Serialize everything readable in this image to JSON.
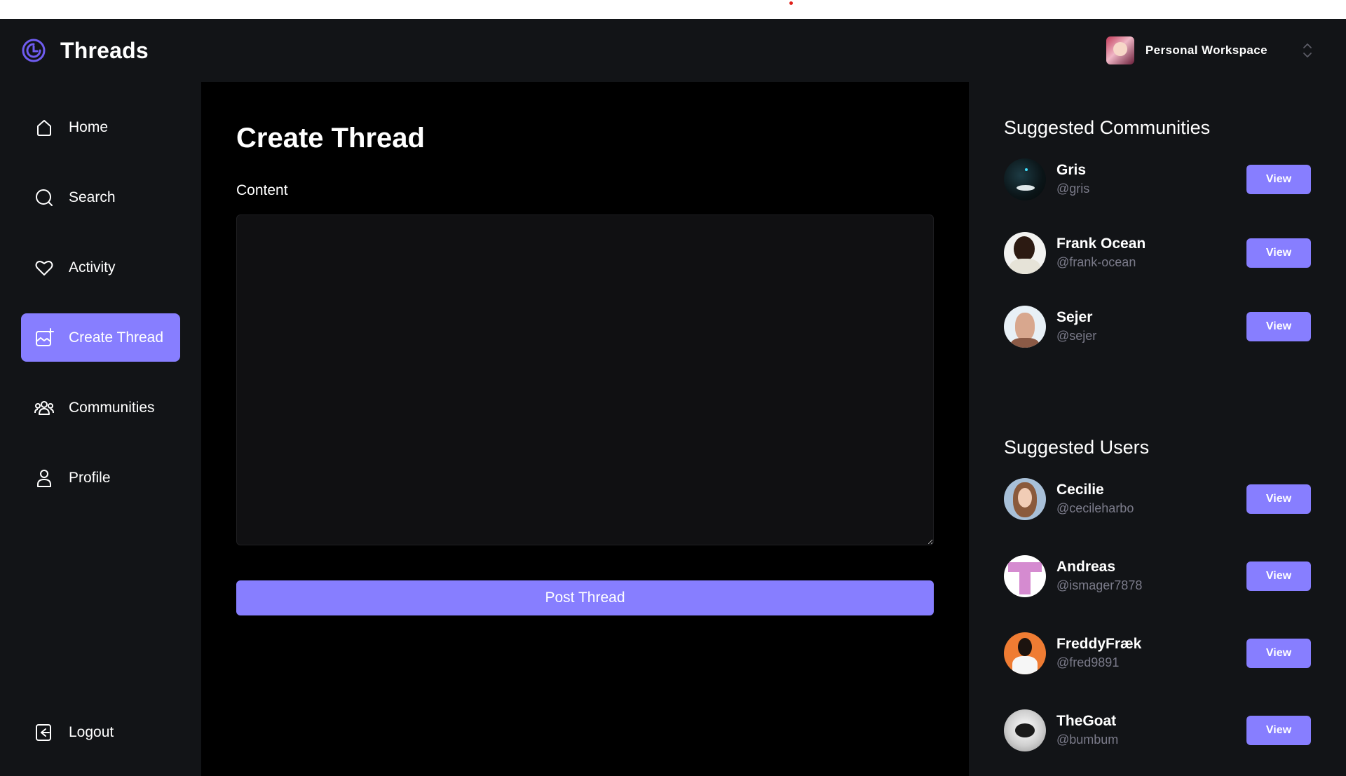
{
  "app": {
    "title": "Threads",
    "accent_color": "#877eff"
  },
  "workspace": {
    "name": "Personal Workspace"
  },
  "nav": {
    "items": [
      {
        "label": "Home",
        "icon": "home-icon",
        "active": false
      },
      {
        "label": "Search",
        "icon": "search-icon",
        "active": false
      },
      {
        "label": "Activity",
        "icon": "heart-icon",
        "active": false
      },
      {
        "label": "Create Thread",
        "icon": "create-thread-icon",
        "active": true
      },
      {
        "label": "Communities",
        "icon": "communities-icon",
        "active": false
      },
      {
        "label": "Profile",
        "icon": "user-icon",
        "active": false
      }
    ],
    "logout_label": "Logout"
  },
  "main": {
    "title": "Create Thread",
    "content_label": "Content",
    "content_value": "",
    "post_button_label": "Post Thread"
  },
  "communities": {
    "title": "Suggested Communities",
    "items": [
      {
        "name": "Gris",
        "handle": "@gris",
        "button": "View"
      },
      {
        "name": "Frank Ocean",
        "handle": "@frank-ocean",
        "button": "View"
      },
      {
        "name": "Sejer",
        "handle": "@sejer",
        "button": "View"
      }
    ]
  },
  "users": {
    "title": "Suggested Users",
    "items": [
      {
        "name": "Cecilie",
        "handle": "@cecileharbo",
        "button": "View"
      },
      {
        "name": "Andreas",
        "handle": "@ismager7878",
        "button": "View"
      },
      {
        "name": "FreddyFræk",
        "handle": "@fred9891",
        "button": "View"
      },
      {
        "name": "TheGoat",
        "handle": "@bumbum",
        "button": "View"
      }
    ]
  }
}
